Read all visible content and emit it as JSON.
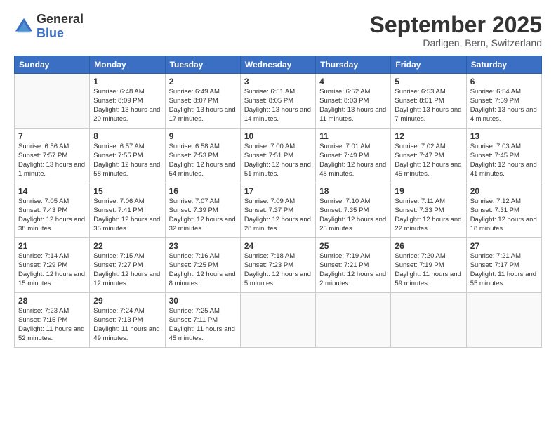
{
  "logo": {
    "general": "General",
    "blue": "Blue"
  },
  "title": "September 2025",
  "subtitle": "Darligen, Bern, Switzerland",
  "days_header": [
    "Sunday",
    "Monday",
    "Tuesday",
    "Wednesday",
    "Thursday",
    "Friday",
    "Saturday"
  ],
  "weeks": [
    [
      {
        "num": "",
        "detail": ""
      },
      {
        "num": "1",
        "detail": "Sunrise: 6:48 AM\nSunset: 8:09 PM\nDaylight: 13 hours\nand 20 minutes."
      },
      {
        "num": "2",
        "detail": "Sunrise: 6:49 AM\nSunset: 8:07 PM\nDaylight: 13 hours\nand 17 minutes."
      },
      {
        "num": "3",
        "detail": "Sunrise: 6:51 AM\nSunset: 8:05 PM\nDaylight: 13 hours\nand 14 minutes."
      },
      {
        "num": "4",
        "detail": "Sunrise: 6:52 AM\nSunset: 8:03 PM\nDaylight: 13 hours\nand 11 minutes."
      },
      {
        "num": "5",
        "detail": "Sunrise: 6:53 AM\nSunset: 8:01 PM\nDaylight: 13 hours\nand 7 minutes."
      },
      {
        "num": "6",
        "detail": "Sunrise: 6:54 AM\nSunset: 7:59 PM\nDaylight: 13 hours\nand 4 minutes."
      }
    ],
    [
      {
        "num": "7",
        "detail": "Sunrise: 6:56 AM\nSunset: 7:57 PM\nDaylight: 13 hours\nand 1 minute."
      },
      {
        "num": "8",
        "detail": "Sunrise: 6:57 AM\nSunset: 7:55 PM\nDaylight: 12 hours\nand 58 minutes."
      },
      {
        "num": "9",
        "detail": "Sunrise: 6:58 AM\nSunset: 7:53 PM\nDaylight: 12 hours\nand 54 minutes."
      },
      {
        "num": "10",
        "detail": "Sunrise: 7:00 AM\nSunset: 7:51 PM\nDaylight: 12 hours\nand 51 minutes."
      },
      {
        "num": "11",
        "detail": "Sunrise: 7:01 AM\nSunset: 7:49 PM\nDaylight: 12 hours\nand 48 minutes."
      },
      {
        "num": "12",
        "detail": "Sunrise: 7:02 AM\nSunset: 7:47 PM\nDaylight: 12 hours\nand 45 minutes."
      },
      {
        "num": "13",
        "detail": "Sunrise: 7:03 AM\nSunset: 7:45 PM\nDaylight: 12 hours\nand 41 minutes."
      }
    ],
    [
      {
        "num": "14",
        "detail": "Sunrise: 7:05 AM\nSunset: 7:43 PM\nDaylight: 12 hours\nand 38 minutes."
      },
      {
        "num": "15",
        "detail": "Sunrise: 7:06 AM\nSunset: 7:41 PM\nDaylight: 12 hours\nand 35 minutes."
      },
      {
        "num": "16",
        "detail": "Sunrise: 7:07 AM\nSunset: 7:39 PM\nDaylight: 12 hours\nand 32 minutes."
      },
      {
        "num": "17",
        "detail": "Sunrise: 7:09 AM\nSunset: 7:37 PM\nDaylight: 12 hours\nand 28 minutes."
      },
      {
        "num": "18",
        "detail": "Sunrise: 7:10 AM\nSunset: 7:35 PM\nDaylight: 12 hours\nand 25 minutes."
      },
      {
        "num": "19",
        "detail": "Sunrise: 7:11 AM\nSunset: 7:33 PM\nDaylight: 12 hours\nand 22 minutes."
      },
      {
        "num": "20",
        "detail": "Sunrise: 7:12 AM\nSunset: 7:31 PM\nDaylight: 12 hours\nand 18 minutes."
      }
    ],
    [
      {
        "num": "21",
        "detail": "Sunrise: 7:14 AM\nSunset: 7:29 PM\nDaylight: 12 hours\nand 15 minutes."
      },
      {
        "num": "22",
        "detail": "Sunrise: 7:15 AM\nSunset: 7:27 PM\nDaylight: 12 hours\nand 12 minutes."
      },
      {
        "num": "23",
        "detail": "Sunrise: 7:16 AM\nSunset: 7:25 PM\nDaylight: 12 hours\nand 8 minutes."
      },
      {
        "num": "24",
        "detail": "Sunrise: 7:18 AM\nSunset: 7:23 PM\nDaylight: 12 hours\nand 5 minutes."
      },
      {
        "num": "25",
        "detail": "Sunrise: 7:19 AM\nSunset: 7:21 PM\nDaylight: 12 hours\nand 2 minutes."
      },
      {
        "num": "26",
        "detail": "Sunrise: 7:20 AM\nSunset: 7:19 PM\nDaylight: 11 hours\nand 59 minutes."
      },
      {
        "num": "27",
        "detail": "Sunrise: 7:21 AM\nSunset: 7:17 PM\nDaylight: 11 hours\nand 55 minutes."
      }
    ],
    [
      {
        "num": "28",
        "detail": "Sunrise: 7:23 AM\nSunset: 7:15 PM\nDaylight: 11 hours\nand 52 minutes."
      },
      {
        "num": "29",
        "detail": "Sunrise: 7:24 AM\nSunset: 7:13 PM\nDaylight: 11 hours\nand 49 minutes."
      },
      {
        "num": "30",
        "detail": "Sunrise: 7:25 AM\nSunset: 7:11 PM\nDaylight: 11 hours\nand 45 minutes."
      },
      {
        "num": "",
        "detail": ""
      },
      {
        "num": "",
        "detail": ""
      },
      {
        "num": "",
        "detail": ""
      },
      {
        "num": "",
        "detail": ""
      }
    ]
  ]
}
